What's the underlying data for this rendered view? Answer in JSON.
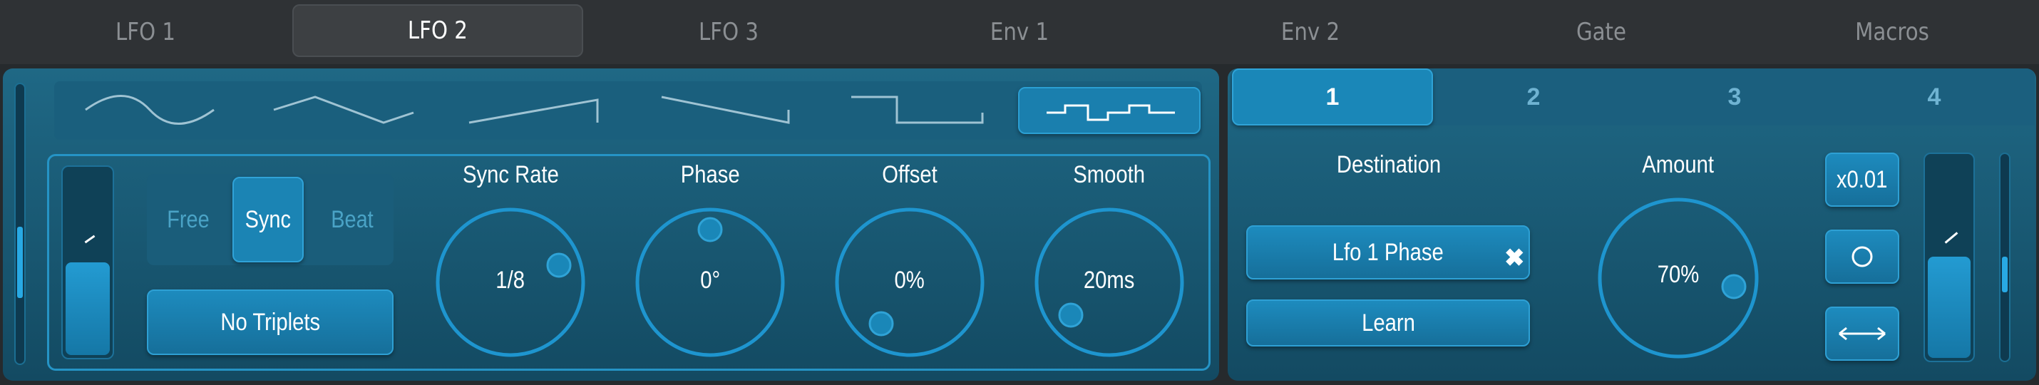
{
  "tabs": [
    {
      "label": "LFO 1",
      "active": false
    },
    {
      "label": "LFO 2",
      "active": true
    },
    {
      "label": "LFO 3",
      "active": false
    },
    {
      "label": "Env 1",
      "active": false
    },
    {
      "label": "Env 2",
      "active": false
    },
    {
      "label": "Gate",
      "active": false
    },
    {
      "label": "Macros",
      "active": false
    }
  ],
  "waveforms": {
    "shapes": [
      "sine-wave-icon",
      "triangle-wave-icon",
      "ramp-up-wave-icon",
      "ramp-down-wave-icon",
      "square-wave-icon",
      "step-wave-icon"
    ],
    "selected": "step-wave-icon"
  },
  "mode": {
    "options": [
      "Free",
      "Sync",
      "Beat"
    ],
    "selected": "Sync"
  },
  "triplets_label": "No Triplets",
  "knobs": {
    "sync_rate": {
      "label": "Sync Rate",
      "value": "1/8"
    },
    "phase": {
      "label": "Phase",
      "value": "0°"
    },
    "offset": {
      "label": "Offset",
      "value": "0%"
    },
    "smooth": {
      "label": "Smooth",
      "value": "20ms"
    }
  },
  "mod_slots": {
    "tabs": [
      "1",
      "2",
      "3",
      "4"
    ],
    "selected": "1"
  },
  "destination": {
    "label": "Destination",
    "value": "Lfo 1 Phase",
    "clear_icon": "✖",
    "learn_label": "Learn"
  },
  "amount": {
    "label": "Amount",
    "value": "70%"
  },
  "multiplier_label": "x0.01",
  "colors": {
    "accent": "#1a87b8",
    "panel_top": "#1f6885",
    "panel_bottom": "#134a62",
    "ring": "#1e95cf",
    "background": "#262a2d"
  }
}
